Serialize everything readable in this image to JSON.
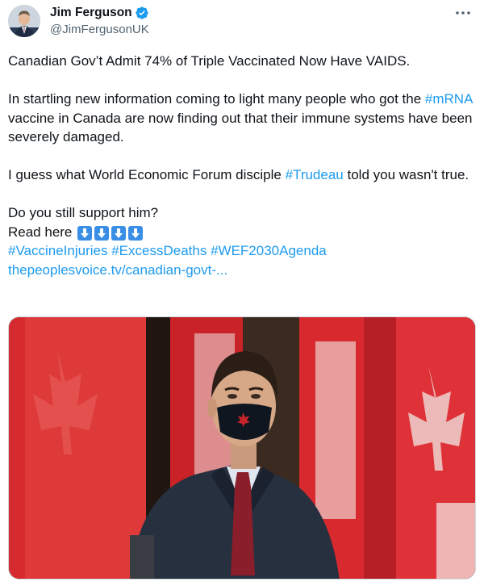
{
  "tweet": {
    "author_name": "Jim Ferguson",
    "author_handle": "@JimFergusonUK",
    "headline": "Canadian Gov’t Admit 74% of Triple Vaccinated Now Have VAIDS.",
    "para2_before": "In startling new information coming to light many people who got the ",
    "para2_tag": "#mRNA",
    "para2_after": " vaccine in Canada are now finding out that their immune systems have been severely damaged.",
    "para3_before": "I guess what World Economic Forum disciple ",
    "para3_tag": "#Trudeau",
    "para3_after": " told you wasn't true.",
    "question": "Do you still support him?",
    "read_here": "Read here",
    "arrows_emoji": "⬇️⬇️⬇️⬇️",
    "hashtags": [
      "#VaccineInjuries",
      "#ExcessDeaths",
      "#WEF2030Agenda"
    ],
    "link_text": "thepeoplesvoice.tv/canadian-govt-..."
  },
  "icons": {
    "verified": "verified-badge-icon",
    "more": "more-options-icon",
    "arrow": "down-arrow-emoji"
  },
  "colors": {
    "link": "#1d9bf0",
    "verified": "#1d9bf0",
    "text": "#0f1419",
    "secondary": "#536471",
    "flag_red": "#d8292f"
  }
}
